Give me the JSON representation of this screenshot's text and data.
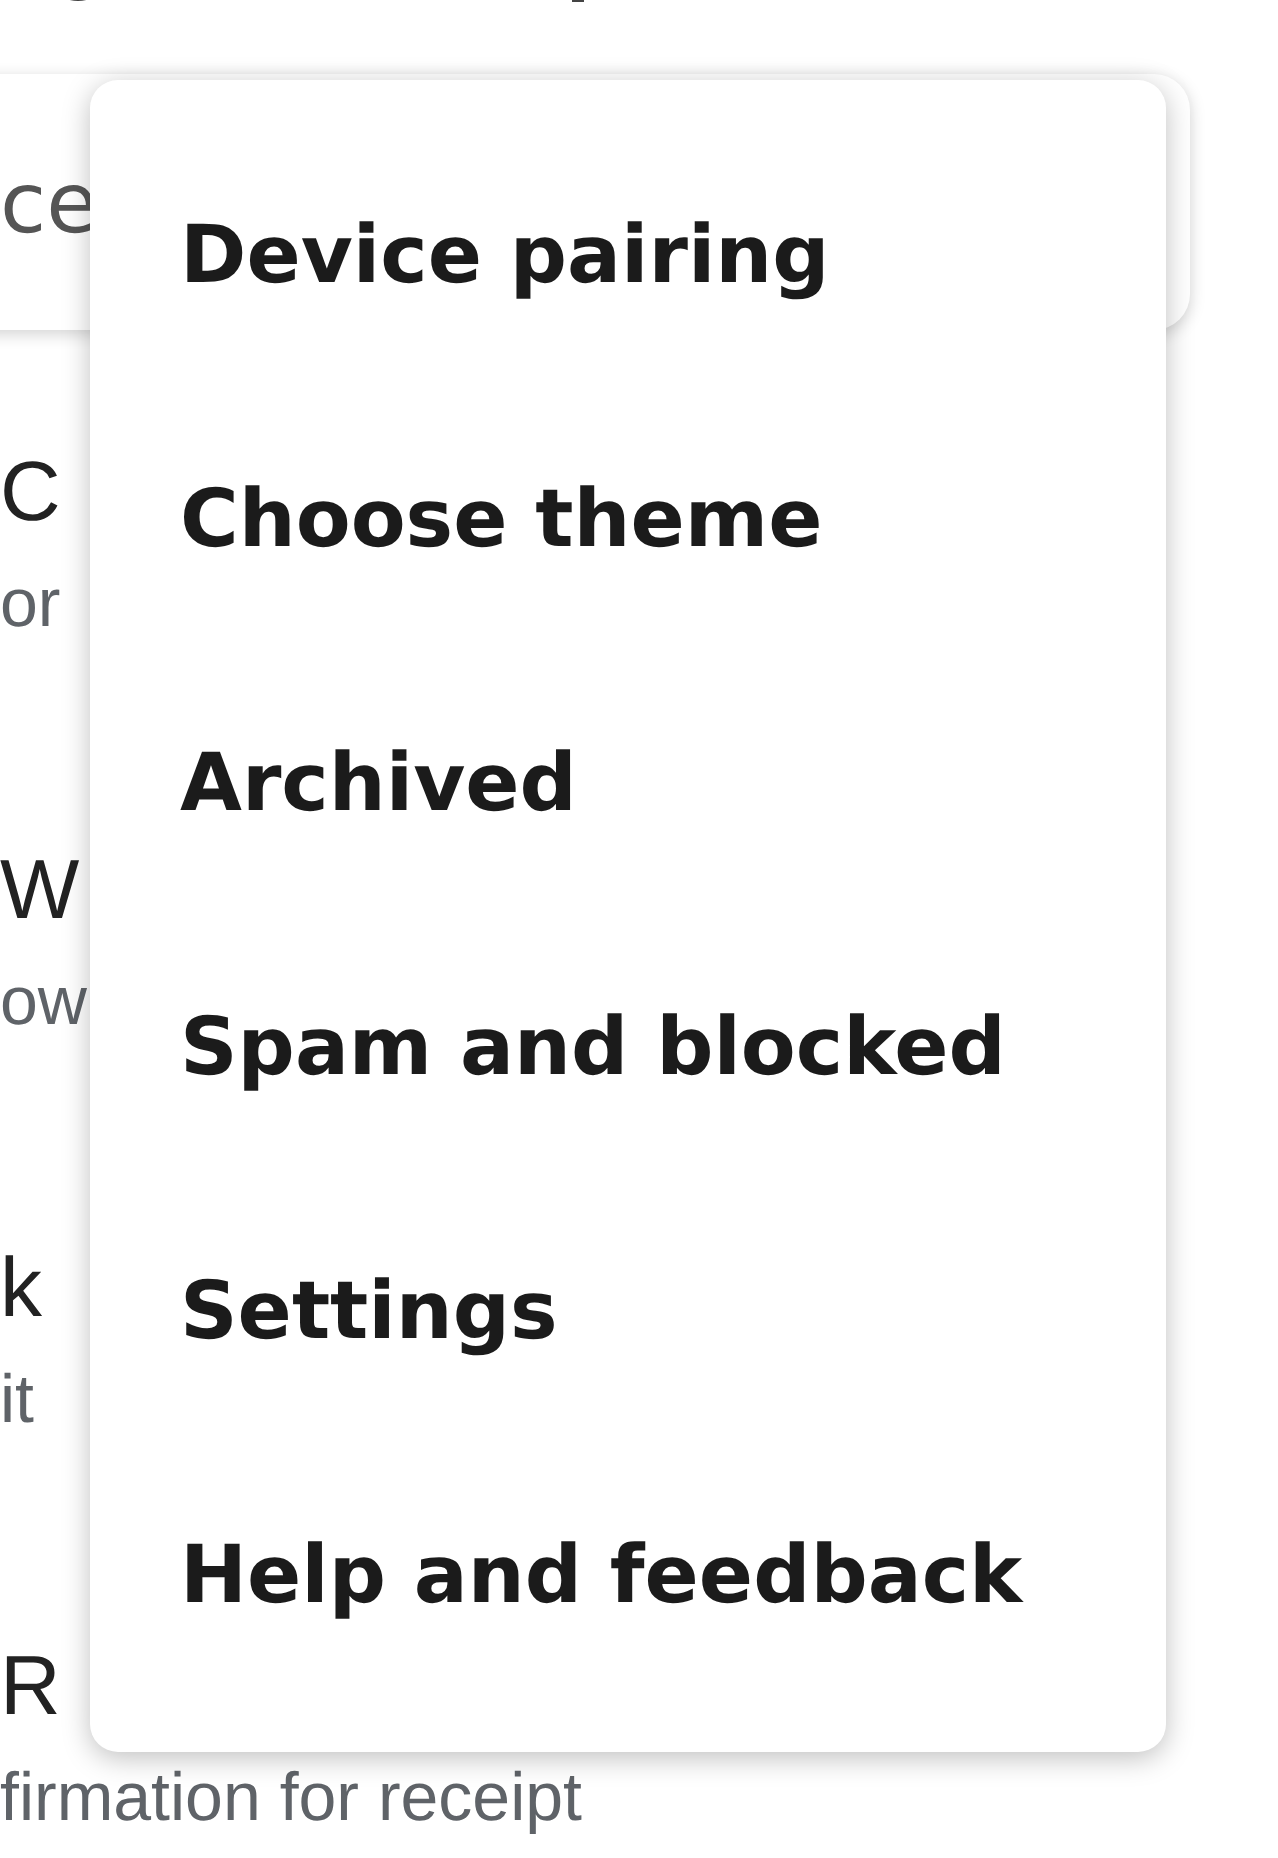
{
  "search": {
    "value": "ce"
  },
  "list": [
    {
      "title": "C",
      "subtitle": "or"
    },
    {
      "title": "W",
      "subtitle": "ow"
    },
    {
      "title": "k",
      "subtitle": "it"
    },
    {
      "title": "R",
      "subtitle": "firmation for receipt"
    }
  ],
  "menu": [
    {
      "label": "Device pairing"
    },
    {
      "label": "Choose theme"
    },
    {
      "label": "Archived"
    },
    {
      "label": "Spam and blocked"
    },
    {
      "label": "Settings"
    },
    {
      "label": "Help and feedback"
    }
  ]
}
